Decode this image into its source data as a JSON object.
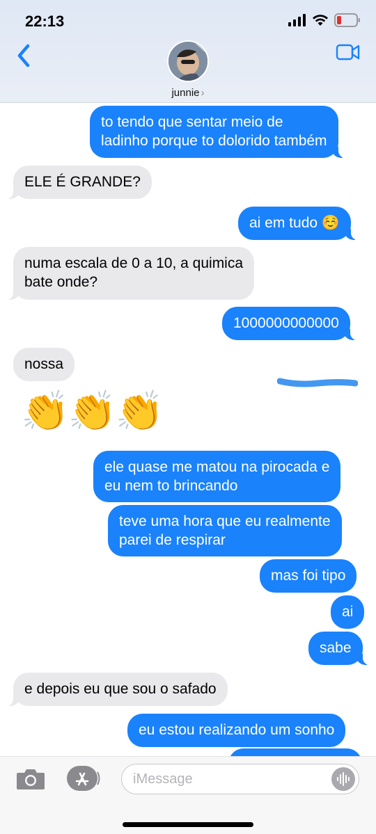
{
  "status_bar": {
    "time": "22:13"
  },
  "header": {
    "contact_name": "junnie",
    "contact_chevron": "›"
  },
  "messages": [
    {
      "dir": "out",
      "lines": [
        "to tendo que sentar meio de",
        "ladinho porque to dolorido também"
      ]
    },
    {
      "dir": "in",
      "lines": [
        "ELE É GRANDE?"
      ]
    },
    {
      "dir": "out",
      "lines": [
        "ai em tudo ☺️"
      ]
    },
    {
      "dir": "in",
      "lines": [
        "numa escala de 0 a 10, a quimica",
        "bate onde?"
      ]
    },
    {
      "dir": "out",
      "lines": [
        "1000000000000"
      ]
    },
    {
      "dir": "in",
      "lines": [
        "nossa"
      ]
    },
    {
      "dir": "in",
      "emoji": "👏👏👏"
    },
    {
      "dir": "out",
      "lines": [
        "ele quase me matou na pirocada e",
        "eu nem to brincando"
      ]
    },
    {
      "dir": "out",
      "lines": [
        "teve uma hora que eu realmente",
        "parei de respirar"
      ]
    },
    {
      "dir": "out",
      "lines": [
        "mas foi tipo"
      ]
    },
    {
      "dir": "out",
      "lines": [
        "ai"
      ]
    },
    {
      "dir": "out",
      "lines": [
        "sabe"
      ]
    },
    {
      "dir": "in",
      "lines": [
        "e depois eu que sou o safado"
      ]
    },
    {
      "dir": "out",
      "lines": [
        "eu estou realizando um sonho"
      ]
    }
  ],
  "input": {
    "placeholder": "iMessage",
    "value": ""
  },
  "icons": {
    "back": "chevron-left-icon",
    "video": "video-camera-icon",
    "camera": "camera-icon",
    "apps": "app-store-icon",
    "audio": "audio-waveform-icon"
  },
  "colors": {
    "accent": "#1a82fb",
    "incoming": "#e9e9eb",
    "battery_low": "#e0312a"
  }
}
